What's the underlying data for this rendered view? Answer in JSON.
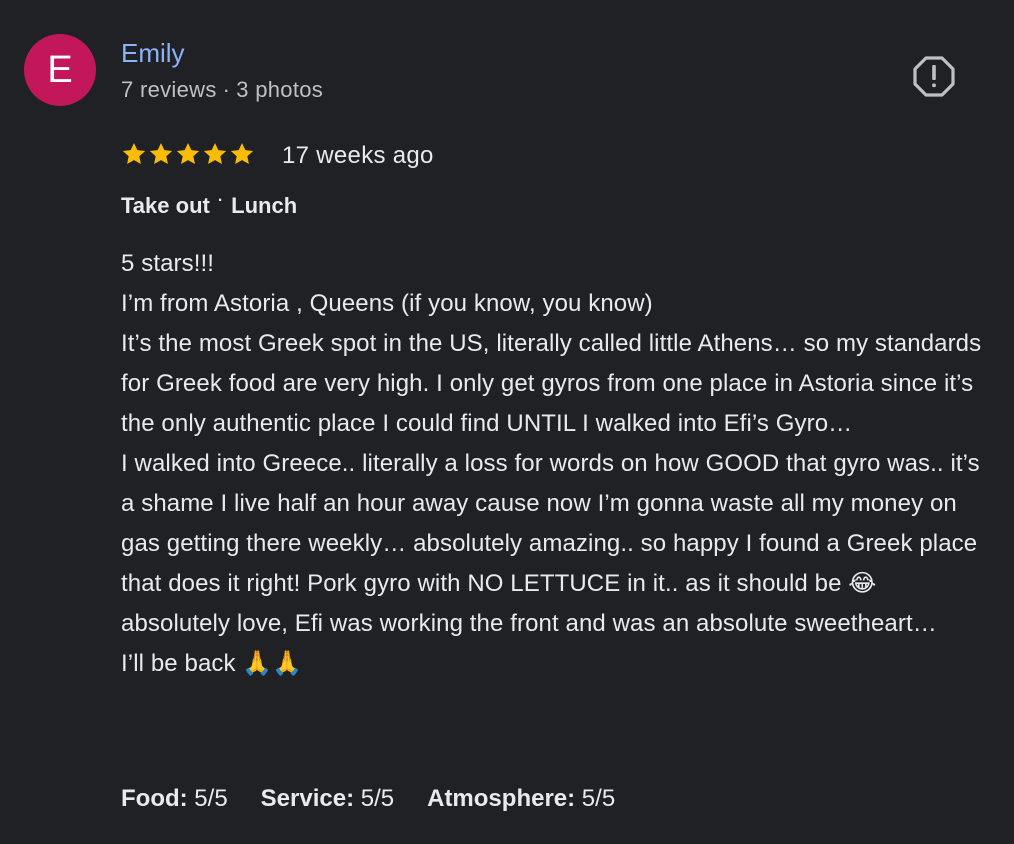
{
  "reviewer": {
    "initial": "E",
    "avatar_color": "#c2185b",
    "name": "Emily",
    "reviews": "7 reviews",
    "dot": "·",
    "photos": "3 photos"
  },
  "report_icon": "report-flag-icon",
  "rating": {
    "stars": 5,
    "max": 5,
    "star_color": "#fbbc04",
    "time_ago": "17 weeks ago"
  },
  "tags": {
    "service_type": "Take out",
    "separator": "·",
    "meal": "Lunch"
  },
  "review_text": [
    "5 stars!!!",
    "I’m from Astoria , Queens (if you know, you know)",
    "It’s the most Greek spot in the US, literally called little Athens… so my standards for Greek food are very high. I only get gyros from one place in Astoria since it’s the only authentic place I could find UNTIL I walked into Efi’s Gyro…",
    "I walked into Greece.. literally a loss for words on how GOOD that gyro was.. it’s a shame I live half an hour away cause now I’m gonna waste all my money on gas getting there weekly… absolutely amazing.. so happy I found a Greek place that does it right! Pork gyro with NO LETTUCE in it.. as it should be 😂 absolutely love, Efi was working the front and was an absolute sweetheart…",
    "I’ll be back 🙏🙏"
  ],
  "scores": [
    {
      "label": "Food:",
      "value": "5/5"
    },
    {
      "label": "Service:",
      "value": "5/5"
    },
    {
      "label": "Atmosphere:",
      "value": "5/5"
    }
  ]
}
